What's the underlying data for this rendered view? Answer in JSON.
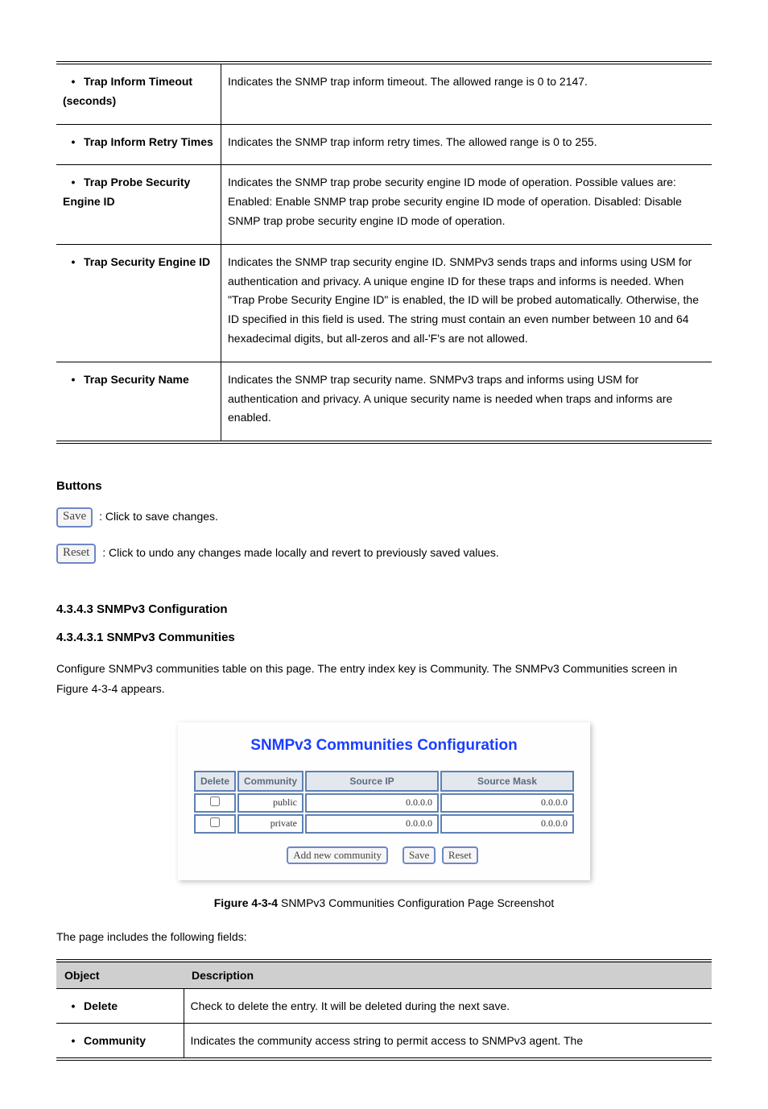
{
  "topTable": {
    "rows": [
      {
        "label": "Trap Inform Timeout (seconds)",
        "desc": "Indicates the SNMP trap inform timeout. The allowed range is 0 to 2147."
      },
      {
        "label": "Trap Inform Retry Times",
        "desc": "Indicates the SNMP trap inform retry times. The allowed range is 0 to 255."
      },
      {
        "label": "Trap Probe Security Engine ID",
        "desc": "Indicates the SNMP trap probe security engine ID mode of operation. Possible values are: Enabled: Enable SNMP trap probe security engine ID mode of operation. Disabled: Disable SNMP trap probe security engine ID mode of operation."
      },
      {
        "label": "Trap Security Engine ID",
        "desc": "Indicates the SNMP trap security engine ID. SNMPv3 sends traps and informs using USM for authentication and privacy. A unique engine ID for these traps and informs is needed. When \"Trap Probe Security Engine ID\" is enabled, the ID will be probed automatically. Otherwise, the ID specified in this field is used. The string must contain an even number between 10 and 64 hexadecimal digits, but all-zeros and all-'F's are not allowed."
      },
      {
        "label": "Trap Security Name",
        "desc": "Indicates the SNMP trap security name. SNMPv3 traps and informs using USM for authentication and privacy. A unique security name is needed when traps and informs are enabled."
      }
    ]
  },
  "buttons": {
    "heading": "Buttons",
    "saveLabel": "Save",
    "saveDesc": ": Click to save changes.",
    "resetLabel": "Reset",
    "resetDesc": ": Click to undo any changes made locally and revert to previously saved values."
  },
  "section": {
    "heading": "4.3.4.3 SNMPv3 Configuration",
    "subheading": "4.3.4.3.1 SNMPv3 Communities",
    "intro": "Configure SNMPv3 communities table on this page. The entry index key is Community. The SNMPv3 Communities screen in Figure 4-3-4 appears."
  },
  "figure": {
    "title": "SNMPv3 Communities Configuration",
    "headers": [
      "Delete",
      "Community",
      "Source IP",
      "Source Mask"
    ],
    "rows": [
      {
        "community": "public",
        "ip": "0.0.0.0",
        "mask": "0.0.0.0"
      },
      {
        "community": "private",
        "ip": "0.0.0.0",
        "mask": "0.0.0.0"
      }
    ],
    "buttons": {
      "add": "Add new community",
      "save": "Save",
      "reset": "Reset"
    },
    "captionBold": "Figure 4-3-4",
    "captionRest": " SNMPv3 Communities Configuration Page Screenshot"
  },
  "bottom": {
    "intro": "The page includes the following fields:",
    "headers": [
      "Object",
      "Description"
    ],
    "rows": [
      {
        "label": "Delete",
        "desc": "Check to delete the entry. It will be deleted during the next save."
      },
      {
        "label": "Community",
        "desc": "Indicates the community access string to permit access to SNMPv3 agent. The"
      }
    ]
  }
}
